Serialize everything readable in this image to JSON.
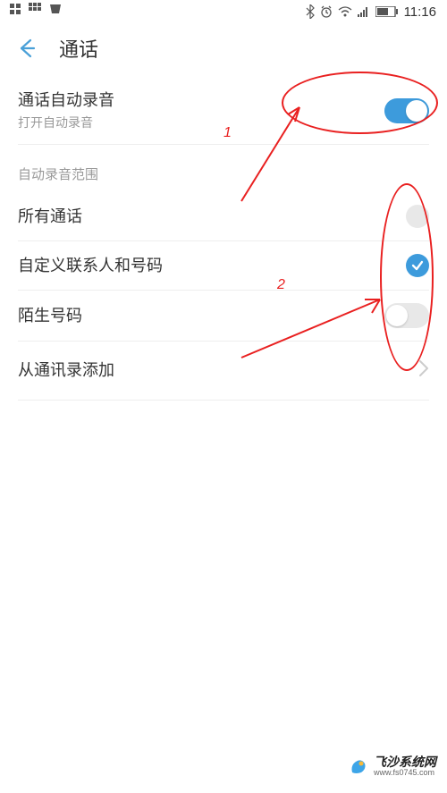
{
  "statusBar": {
    "time": "11:16"
  },
  "header": {
    "title": "通话"
  },
  "autoRecord": {
    "title": "通话自动录音",
    "subtitle": "打开自动录音",
    "enabled": true
  },
  "sectionHeader": "自动录音范围",
  "options": {
    "allCalls": {
      "label": "所有通话",
      "selected": false
    },
    "customContacts": {
      "label": "自定义联系人和号码",
      "selected": true
    },
    "strangerNumbers": {
      "label": "陌生号码",
      "toggled": false
    }
  },
  "addFromContacts": {
    "label": "从通讯录添加"
  },
  "annotations": {
    "label1": "1",
    "label2": "2"
  },
  "watermark": {
    "title": "飞沙系统网",
    "url": "www.fs0745.com"
  }
}
